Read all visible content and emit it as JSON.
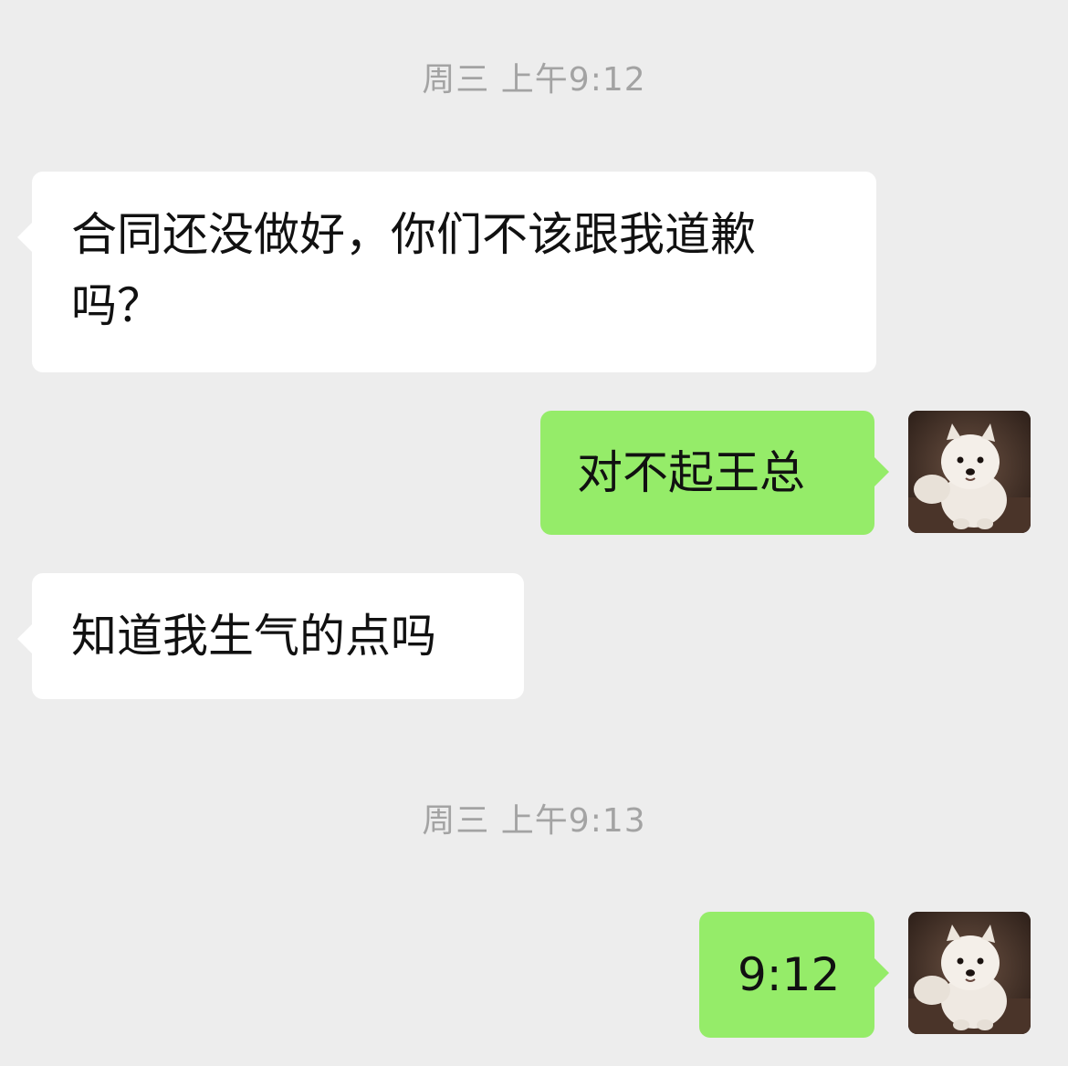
{
  "timestamps": [
    "周三 上午9:12",
    "周三 上午9:13"
  ],
  "messages": [
    {
      "from": "other",
      "text": "合同还没做好，你们不该跟我道歉吗？"
    },
    {
      "from": "self",
      "text": "对不起王总"
    },
    {
      "from": "other",
      "text": "知道我生气的点吗"
    },
    {
      "from": "self",
      "text": "9:12"
    }
  ],
  "avatar": {
    "icon": "samoyed-dog-avatar-icon"
  },
  "colors": {
    "background": "#EDEDED",
    "incoming": "#FFFFFF",
    "outgoing": "#95EC69",
    "timestamp": "#A3A3A3"
  }
}
